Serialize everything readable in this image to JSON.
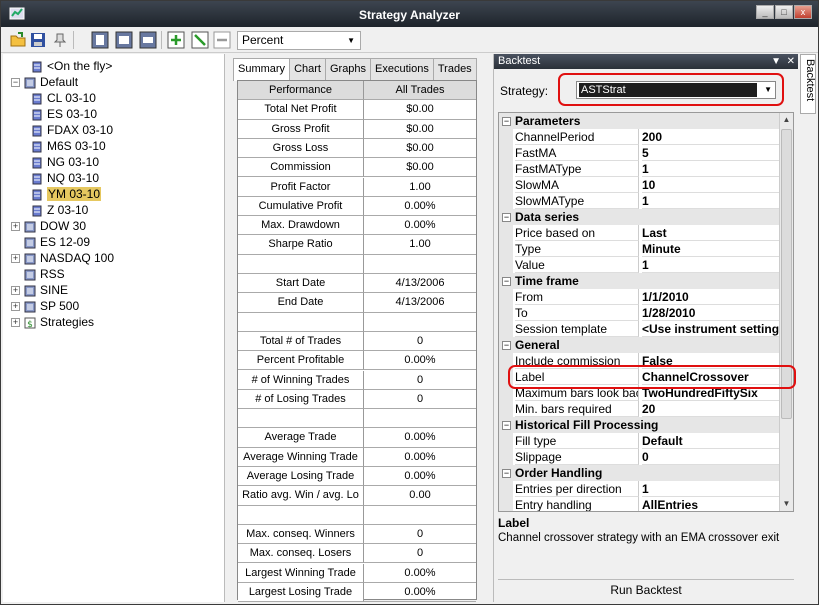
{
  "window": {
    "title": "Strategy Analyzer"
  },
  "toolbar": {
    "combo_value": "Percent"
  },
  "tree": [
    {
      "label": "<On the fly>",
      "depth": 1,
      "exp": "",
      "icon": "db"
    },
    {
      "label": "Default",
      "depth": 0,
      "exp": "−",
      "icon": "list"
    },
    {
      "label": "CL 03-10",
      "depth": 1,
      "exp": "",
      "icon": "db"
    },
    {
      "label": "ES 03-10",
      "depth": 1,
      "exp": "",
      "icon": "db"
    },
    {
      "label": "FDAX 03-10",
      "depth": 1,
      "exp": "",
      "icon": "db"
    },
    {
      "label": "M6S 03-10",
      "depth": 1,
      "exp": "",
      "icon": "db"
    },
    {
      "label": "NG 03-10",
      "depth": 1,
      "exp": "",
      "icon": "db"
    },
    {
      "label": "NQ 03-10",
      "depth": 1,
      "exp": "",
      "icon": "db"
    },
    {
      "label": "YM 03-10",
      "depth": 1,
      "exp": "",
      "icon": "db",
      "selected": true
    },
    {
      "label": "Z 03-10",
      "depth": 1,
      "exp": "",
      "icon": "db"
    },
    {
      "label": "DOW 30",
      "depth": 0,
      "exp": "+",
      "icon": "list"
    },
    {
      "label": "ES 12-09",
      "depth": 0,
      "exp": "",
      "icon": "list"
    },
    {
      "label": "NASDAQ 100",
      "depth": 0,
      "exp": "+",
      "icon": "list"
    },
    {
      "label": "RSS",
      "depth": 0,
      "exp": "",
      "icon": "list"
    },
    {
      "label": "SINE",
      "depth": 0,
      "exp": "+",
      "icon": "list"
    },
    {
      "label": "SP 500",
      "depth": 0,
      "exp": "+",
      "icon": "list"
    },
    {
      "label": "Strategies",
      "depth": 0,
      "exp": "+",
      "icon": "dollar"
    }
  ],
  "summary": {
    "tabs": [
      {
        "label": "Summary",
        "active": true
      },
      {
        "label": "Chart"
      },
      {
        "label": "Graphs"
      },
      {
        "label": "Executions"
      },
      {
        "label": "Trades"
      }
    ],
    "header": [
      "Performance",
      "All Trades"
    ],
    "rows": [
      [
        "Total Net Profit",
        "$0.00"
      ],
      [
        "Gross Profit",
        "$0.00"
      ],
      [
        "Gross Loss",
        "$0.00"
      ],
      [
        "Commission",
        "$0.00"
      ],
      [
        "Profit Factor",
        "1.00"
      ],
      [
        "Cumulative Profit",
        "0.00%"
      ],
      [
        "Max. Drawdown",
        "0.00%"
      ],
      [
        "Sharpe Ratio",
        "1.00"
      ],
      [
        "",
        ""
      ],
      [
        "Start Date",
        "4/13/2006"
      ],
      [
        "End Date",
        "4/13/2006"
      ],
      [
        "",
        ""
      ],
      [
        "Total # of Trades",
        "0"
      ],
      [
        "Percent Profitable",
        "0.00%"
      ],
      [
        "# of Winning Trades",
        "0"
      ],
      [
        "# of Losing Trades",
        "0"
      ],
      [
        "",
        ""
      ],
      [
        "Average Trade",
        "0.00%"
      ],
      [
        "Average Winning Trade",
        "0.00%"
      ],
      [
        "Average Losing Trade",
        "0.00%"
      ],
      [
        "Ratio avg. Win / avg. Lo",
        "0.00"
      ],
      [
        "",
        ""
      ],
      [
        "Max. conseq. Winners",
        "0"
      ],
      [
        "Max. conseq. Losers",
        "0"
      ],
      [
        "Largest Winning Trade",
        "0.00%"
      ],
      [
        "Largest Losing Trade",
        "0.00%"
      ]
    ]
  },
  "backtest": {
    "panel_title": "Backtest",
    "strategy_label": "Strategy:",
    "strategy_value": "ASTStrat",
    "sections": [
      {
        "name": "Parameters",
        "items": [
          [
            "ChannelPeriod",
            "200"
          ],
          [
            "FastMA",
            "5"
          ],
          [
            "FastMAType",
            "1"
          ],
          [
            "SlowMA",
            "10"
          ],
          [
            "SlowMAType",
            "1"
          ]
        ]
      },
      {
        "name": "Data series",
        "items": [
          [
            "Price based on",
            "Last"
          ],
          [
            "Type",
            "Minute"
          ],
          [
            "Value",
            "1"
          ]
        ]
      },
      {
        "name": "Time frame",
        "items": [
          [
            "From",
            "1/1/2010"
          ],
          [
            "To",
            "1/28/2010"
          ],
          [
            "Session template",
            "<Use instrument settings>"
          ]
        ]
      },
      {
        "name": "General",
        "items": [
          [
            "Include commission",
            "False"
          ],
          [
            "Label",
            "ChannelCrossover"
          ],
          [
            "Maximum bars look back",
            "TwoHundredFiftySix"
          ],
          [
            "Min. bars required",
            "20"
          ]
        ]
      },
      {
        "name": "Historical Fill Processing",
        "items": [
          [
            "Fill type",
            "Default"
          ],
          [
            "Slippage",
            "0"
          ]
        ]
      },
      {
        "name": "Order Handling",
        "items": [
          [
            "Entries per direction",
            "1"
          ],
          [
            "Entry handling",
            "AllEntries"
          ]
        ]
      }
    ],
    "desc_title": "Label",
    "desc_text": "Channel crossover strategy with an EMA crossover exit",
    "run_button": "Run Backtest",
    "side_tab": "Backtest"
  }
}
